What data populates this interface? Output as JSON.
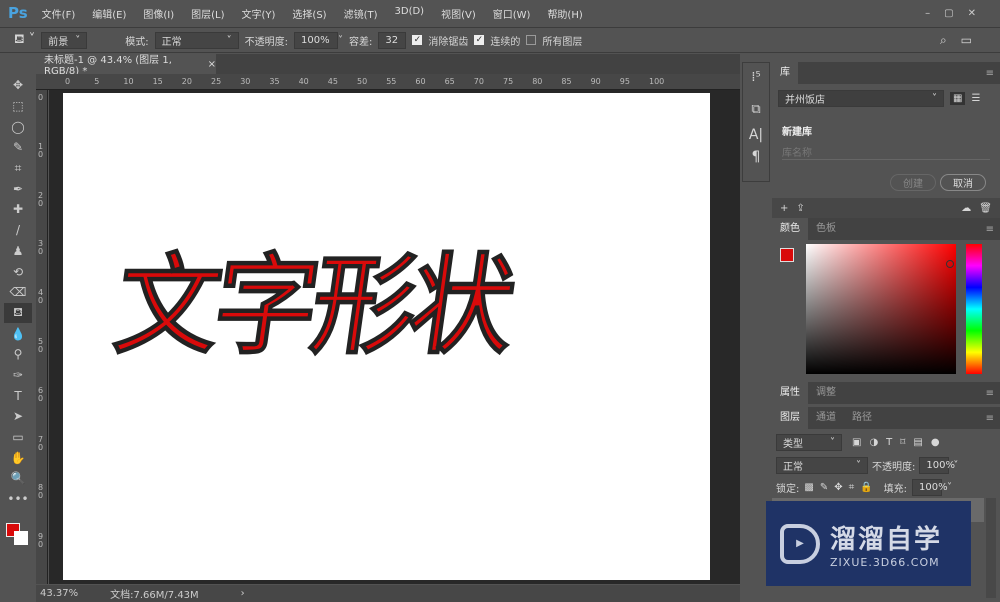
{
  "app": {
    "logo": "Ps"
  },
  "menu": [
    "文件(F)",
    "编辑(E)",
    "图像(I)",
    "图层(L)",
    "文字(Y)",
    "选择(S)",
    "滤镜(T)",
    "3D(D)",
    "视图(V)",
    "窗口(W)",
    "帮助(H)"
  ],
  "options": {
    "fill_source": "前景",
    "mode_label": "模式:",
    "mode_value": "正常",
    "opacity_label": "不透明度:",
    "opacity_value": "100%",
    "tolerance_label": "容差:",
    "tolerance_value": "32",
    "antialias_label": "消除锯齿",
    "antialias": true,
    "contiguous_label": "连续的",
    "contiguous": true,
    "all_layers_label": "所有图层",
    "all_layers": false
  },
  "document": {
    "tab_title": "未标题-1 @ 43.4% (图层 1, RGB/8) *",
    "close": "×",
    "text": "文字形状",
    "text_color": "#d90a0a"
  },
  "rulers": {
    "horizontal": [
      "0",
      "5",
      "10",
      "15",
      "20",
      "25",
      "30",
      "35",
      "40",
      "45",
      "50",
      "55",
      "60",
      "65",
      "70",
      "75",
      "80",
      "85",
      "90",
      "95",
      "100"
    ],
    "vertical": [
      "0",
      "10",
      "20",
      "30",
      "40",
      "50",
      "60",
      "70",
      "80",
      "90"
    ]
  },
  "status": {
    "zoom": "43.37%",
    "doc": "文档:7.66M/7.43M",
    "arrow": "›"
  },
  "tools": [
    "move",
    "marquee",
    "lasso",
    "quick-select",
    "crop",
    "eyedropper",
    "healing",
    "brush",
    "stamp",
    "history-brush",
    "eraser",
    "paint-bucket",
    "blur",
    "dodge",
    "pen",
    "type",
    "path-select",
    "rectangle",
    "hand",
    "zoom",
    "more"
  ],
  "colors": {
    "foreground": "#d90a0a",
    "background": "#ffffff"
  },
  "libraries": {
    "tab": "库",
    "library_name": "并州饭店",
    "new_library": "新建库",
    "name_placeholder": "库名称",
    "create": "创建",
    "cancel": "取消"
  },
  "color_panel": {
    "tabs": [
      "颜色",
      "色板"
    ]
  },
  "properties_panel": {
    "tabs": [
      "属性",
      "调整"
    ]
  },
  "layers_panel": {
    "tabs": [
      "图层",
      "通道",
      "路径"
    ],
    "filter": "类型",
    "blend": "正常",
    "opacity_label": "不透明度:",
    "opacity": "100%",
    "lock_label": "锁定:",
    "fill_label": "填充:",
    "fill": "100%"
  },
  "watermark": {
    "title": "溜溜自学",
    "url": "ZIXUE.3D66.COM"
  }
}
